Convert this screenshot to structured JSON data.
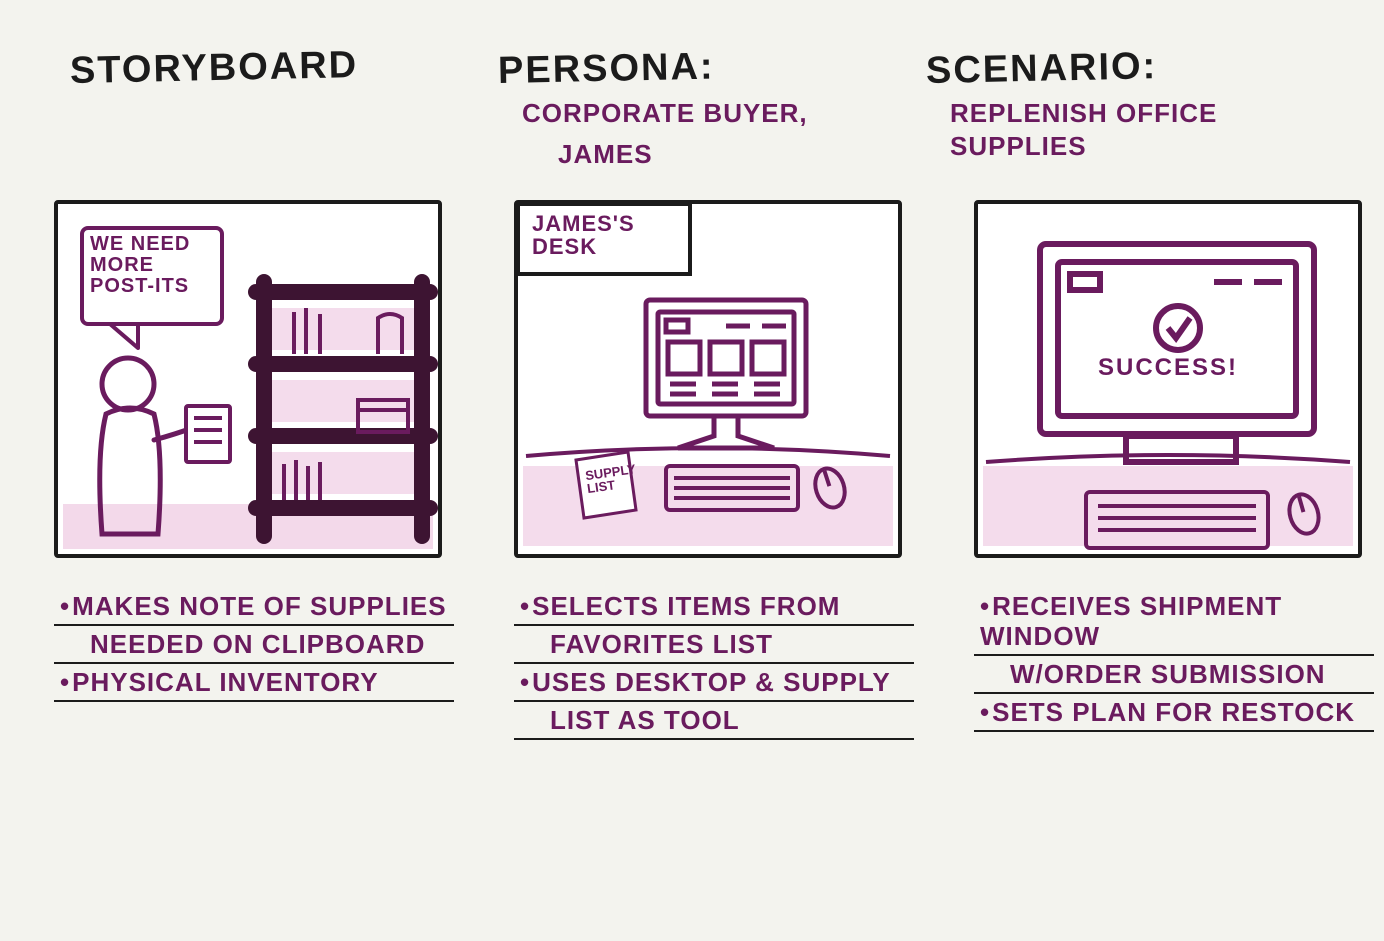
{
  "header": {
    "storyboard_title": "STORYBOARD",
    "persona_title": "PERSONA:",
    "persona_sub1": "CORPORATE BUYER,",
    "persona_sub2": "JAMES",
    "scenario_title": "SCENARIO:",
    "scenario_sub": "REPLENISH OFFICE SUPPLIES"
  },
  "panels": {
    "p1": {
      "speech": "WE NEED MORE POST-ITS",
      "caption1a": "MAKES NOTE OF SUPPLIES",
      "caption1b": "NEEDED ON CLIPBOARD",
      "caption2": "PHYSICAL INVENTORY"
    },
    "p2": {
      "label_top": "JAMES'S DESK",
      "label_note": "SUPPLY LIST",
      "caption1a": "SELECTS ITEMS FROM",
      "caption1b": "FAVORITES LIST",
      "caption2a": "USES DESKTOP & SUPPLY",
      "caption2b": "LIST AS TOOL"
    },
    "p3": {
      "screen_text": "SUCCESS!",
      "caption1a": "RECEIVES SHIPMENT WINDOW",
      "caption1b": "W/ORDER SUBMISSION",
      "caption2": "SETS PLAN FOR RESTOCK"
    }
  },
  "colors": {
    "ink": "#1b1b1b",
    "purple": "#6a1b5e",
    "wash": "#e9b9d9"
  }
}
